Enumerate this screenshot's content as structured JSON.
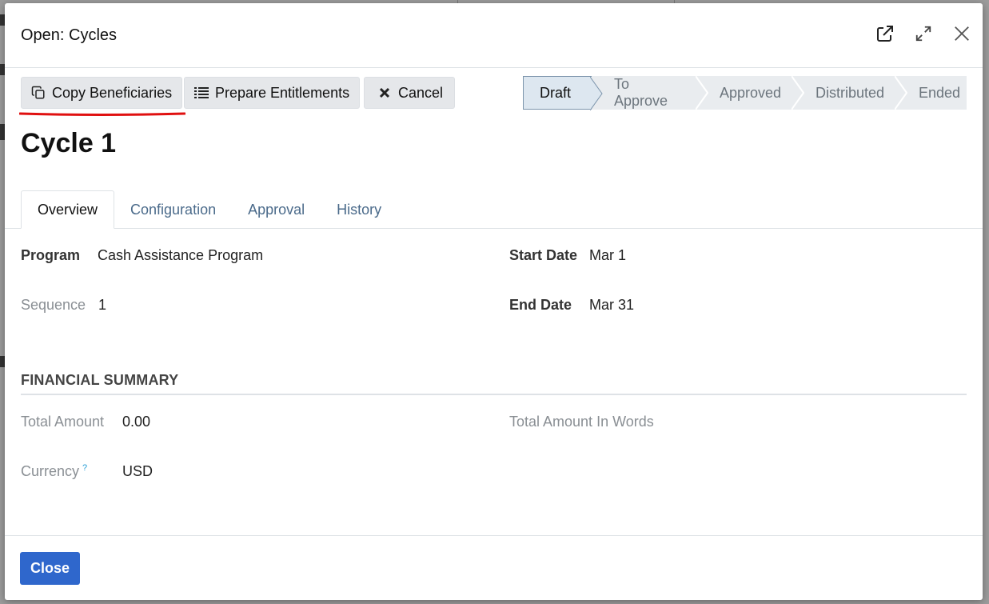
{
  "dialog": {
    "title": "Open: Cycles"
  },
  "toolbar": {
    "copy_beneficiaries": "Copy Beneficiaries",
    "prepare_entitlements": "Prepare Entitlements",
    "cancel": "Cancel"
  },
  "stages": [
    {
      "label": "Draft",
      "active": true
    },
    {
      "label": "To Approve",
      "active": false
    },
    {
      "label": "Approved",
      "active": false
    },
    {
      "label": "Distributed",
      "active": false
    },
    {
      "label": "Ended",
      "active": false
    }
  ],
  "record": {
    "title": "Cycle 1"
  },
  "tabs": [
    {
      "label": "Overview",
      "active": true
    },
    {
      "label": "Configuration",
      "active": false
    },
    {
      "label": "Approval",
      "active": false
    },
    {
      "label": "History",
      "active": false
    }
  ],
  "overview": {
    "program_label": "Program",
    "program_value": "Cash Assistance Program",
    "sequence_label": "Sequence",
    "sequence_value": "1",
    "start_date_label": "Start Date",
    "start_date_value": "Mar 1",
    "end_date_label": "End Date",
    "end_date_value": "Mar 31"
  },
  "financial": {
    "section_title": "FINANCIAL SUMMARY",
    "total_amount_label": "Total Amount",
    "total_amount_value": "0.00",
    "total_words_label": "Total Amount In Words",
    "currency_label": "Currency",
    "currency_help": "?",
    "currency_value": "USD"
  },
  "footer": {
    "close": "Close"
  },
  "colors": {
    "primary": "#2f67cc",
    "annotation_red": "#e01010"
  },
  "icons": {
    "external": "external-link-icon",
    "expand": "expand-icon",
    "close": "close-icon"
  }
}
